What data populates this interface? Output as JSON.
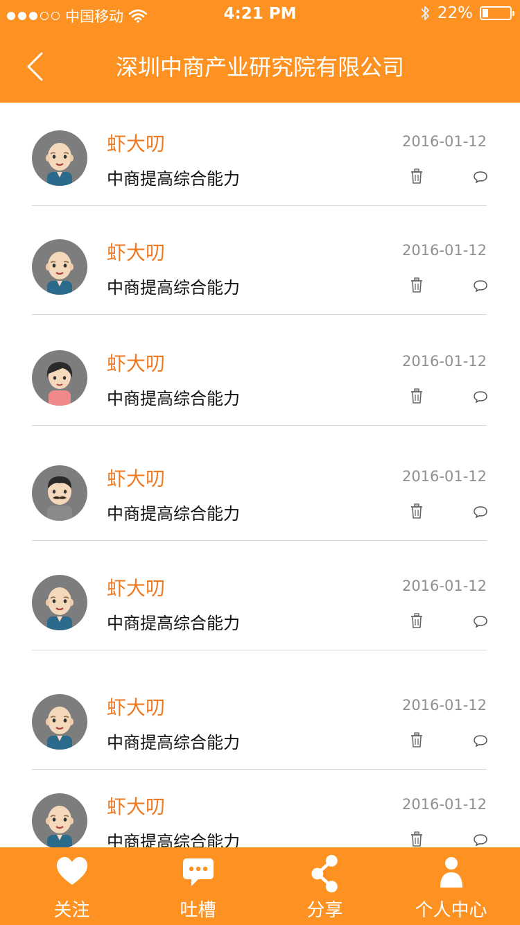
{
  "status_bar": {
    "carrier": "中国移动",
    "time": "4:21 PM",
    "battery": "22%",
    "battery_level": 0.22,
    "signal_bars": 3,
    "icons": [
      "signal-dots-icon",
      "wifi-icon",
      "bluetooth-icon",
      "battery-icon"
    ]
  },
  "header": {
    "title": "深圳中商产业研究院有限公司",
    "back_icon": "chevron-left-icon"
  },
  "colors": {
    "brand": "#FD9223",
    "name": "#F07A22",
    "date": "#8f8f8f",
    "text": "#111111",
    "divider": "#d9d9d9",
    "avatar_bg": "#7d7d7d"
  },
  "comments": [
    {
      "name": "虾大叨",
      "date": "2016-01-12",
      "content": "中商提高综合能力",
      "avatar": "bald-man-avatar"
    },
    {
      "name": "虾大叨",
      "date": "2016-01-12",
      "content": "中商提高综合能力",
      "avatar": "bald-man-avatar"
    },
    {
      "name": "虾大叨",
      "date": "2016-01-12",
      "content": "中商提高综合能力",
      "avatar": "woman-avatar"
    },
    {
      "name": "虾大叨",
      "date": "2016-01-12",
      "content": "中商提高综合能力",
      "avatar": "mustache-man-avatar"
    },
    {
      "name": "虾大叨",
      "date": "2016-01-12",
      "content": "中商提高综合能力",
      "avatar": "bald-man-avatar"
    },
    {
      "name": "虾大叨",
      "date": "2016-01-12",
      "content": "中商提高综合能力",
      "avatar": "bald-man-avatar"
    },
    {
      "name": "虾大叨",
      "date": "2016-01-12",
      "content": "中商提高综合能力",
      "avatar": "bald-man-avatar"
    }
  ],
  "tabs": [
    {
      "label": "关注",
      "icon": "heart-icon"
    },
    {
      "label": "吐槽",
      "icon": "chat-bubble-icon"
    },
    {
      "label": "分享",
      "icon": "share-icon"
    },
    {
      "label": "个人中心",
      "icon": "user-icon"
    }
  ]
}
